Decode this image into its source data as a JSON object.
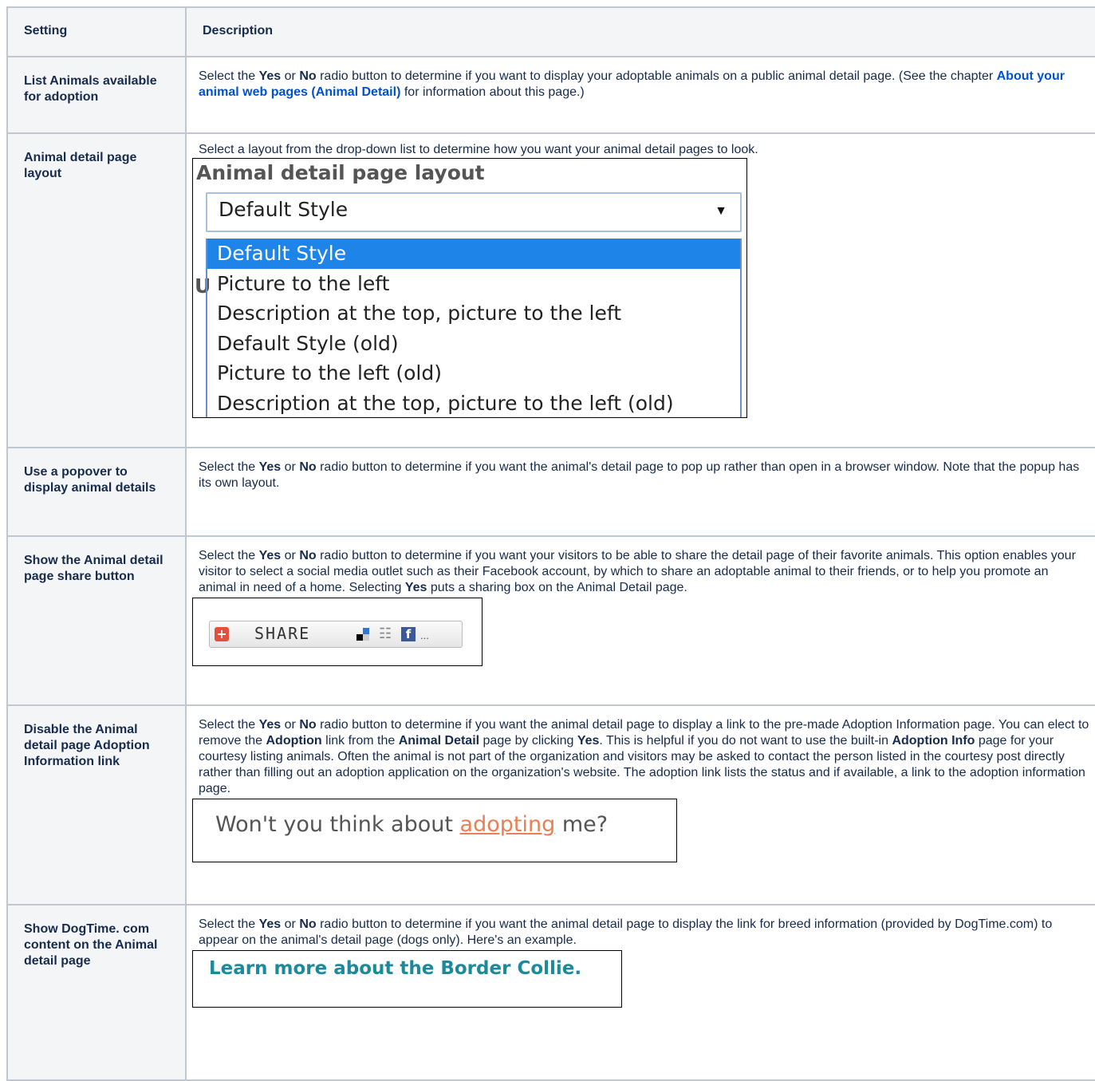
{
  "header": {
    "setting": "Setting",
    "description": "Description"
  },
  "rows": {
    "list_animals": {
      "setting": "List Animals available for adoption",
      "d1": "Select the ",
      "d_yes": "Yes",
      "d_or": " or ",
      "d_no": "No",
      "d2": " radio button to determine if you want to display your adoptable animals on a public animal detail page. (See the chapter ",
      "link": "About your animal web pages (Animal Detail)",
      "d3": " for information about this page.)"
    },
    "layout": {
      "setting": "Animal detail page layout",
      "d1": "Select a layout from the drop-down list to determine how you want your animal detail pages to look.",
      "shot_title": "Animal detail page layout",
      "selected": "Default Style",
      "options": [
        "Default Style",
        "Picture to the left",
        "Description at the top, picture to the left",
        "Default Style (old)",
        "Picture to the left (old)",
        "Description at the top, picture to the left (old)"
      ]
    },
    "popover": {
      "setting": "Use a popover to display animal details",
      "d1": "Select the ",
      "d_yes": "Yes",
      "d_or": " or ",
      "d_no": "No",
      "d2": " radio button to determine if you want the animal's detail page to pop up rather than open in a browser window. Note that the popup has its own layout."
    },
    "share": {
      "setting": "Show the Animal detail page share button",
      "d1": "Select the ",
      "d_yes": "Yes",
      "d_or": " or ",
      "d_no": "No",
      "d2": " radio button to determine if you want your visitors to be able to share the detail page of their favorite animals. This option enables your visitor to select a social media outlet such as their Facebook account, by which to share an adoptable animal to their friends, or to help you promote an animal in need of a home. Selecting ",
      "d_yes2": "Yes",
      "d3": " puts a sharing box on the Animal Detail page.",
      "btn_label": "SHARE",
      "btn_more": "..."
    },
    "adoption": {
      "setting": "Disable the Animal detail page Adoption Information link",
      "d1": "Select the ",
      "d_yes": "Yes",
      "d_or": " or ",
      "d_no": "No",
      "d2": " radio button to determine if you want the animal detail page to display a link to the pre-made Adoption Information page. You can elect to remove the ",
      "d_adoption": "Adoption",
      "d3": " link from the ",
      "d_animal_detail": "Animal Detail",
      "d4": " page by clicking ",
      "d_yes2": "Yes",
      "d5": ". This is helpful if you do not want to use the built-in ",
      "d_adoption_info": "Adoption Info",
      "d6": " page for your courtesy listing animals. Often the animal is not part of the organization and visitors may be asked to contact the person listed in the courtesy post directly rather than filling out an adoption application on the organization's website. The adoption link lists the status and if available, a link to the adoption information page.",
      "shot_pre": "Won't you think about ",
      "shot_link": "adopting",
      "shot_post": " me?"
    },
    "dogtime": {
      "setting": "Show DogTime. com content on the Animal detail page",
      "d1": "Select the ",
      "d_yes": "Yes",
      "d_or": " or ",
      "d_no": "No",
      "d2": " radio button to determine if you want the animal detail page to display the link for breed information (provided by DogTime.com) to appear on the animal's detail page (dogs only). Here's an example.",
      "shot_text": "Learn more about the Border Collie."
    }
  }
}
